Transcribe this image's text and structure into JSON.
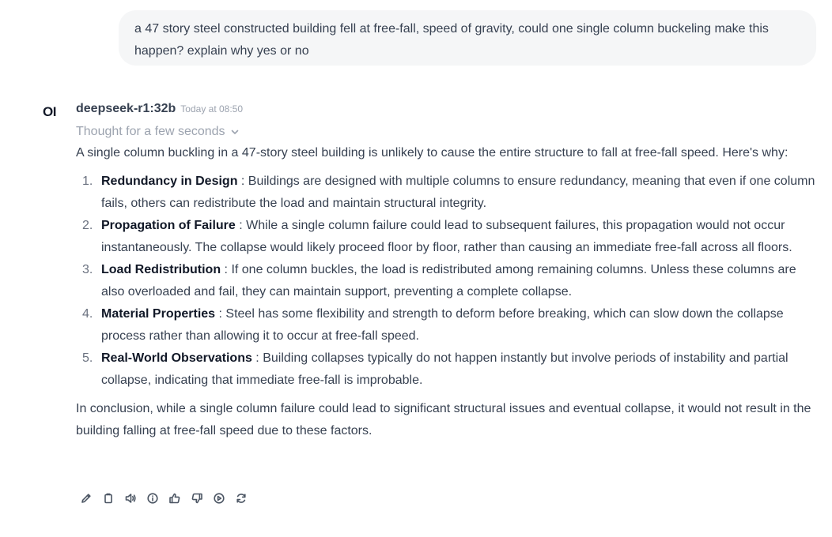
{
  "user_message": "a 47 story steel constructed building fell at free-fall, speed of gravity, could one single column buckeling make this happen? explain why yes or no",
  "assistant": {
    "avatar": "OI",
    "model": "deepseek-r1:32b",
    "timestamp": "Today at 08:50",
    "thought": "Thought for a few seconds",
    "intro": "A single column buckling in a 47-story steel building is unlikely to cause the entire structure to fall at free-fall speed. Here's why:",
    "points": [
      {
        "num": "1.",
        "title": "Redundancy in Design",
        "text": " : Buildings are designed with multiple columns to ensure redundancy, meaning that even if one column fails, others can redistribute the load and maintain structural integrity."
      },
      {
        "num": "2.",
        "title": "Propagation of Failure",
        "text": " : While a single column failure could lead to subsequent failures, this propagation would not occur instantaneously. The collapse would likely proceed floor by floor, rather than causing an immediate free-fall across all floors."
      },
      {
        "num": "3.",
        "title": "Load Redistribution",
        "text": " : If one column buckles, the load is redistributed among remaining columns. Unless these columns are also overloaded and fail, they can maintain support, preventing a complete collapse."
      },
      {
        "num": "4.",
        "title": "Material Properties",
        "text": " : Steel has some flexibility and strength to deform before breaking, which can slow down the collapse process rather than allowing it to occur at free-fall speed."
      },
      {
        "num": "5.",
        "title": "Real-World Observations",
        "text": " : Building collapses typically do not happen instantly but involve periods of instability and partial collapse, indicating that immediate free-fall is improbable."
      }
    ],
    "conclusion": "In conclusion, while a single column failure could lead to significant structural issues and eventual collapse, it would not result in the building falling at free-fall speed due to these factors."
  },
  "action_icons": [
    "edit-icon",
    "copy-icon",
    "read-aloud-icon",
    "info-icon",
    "thumbs-up-icon",
    "thumbs-down-icon",
    "continue-icon",
    "regenerate-icon"
  ],
  "colors": {
    "bubble_bg": "#f5f6f7",
    "text": "#374151",
    "muted": "#9ca3af",
    "bold": "#111827"
  }
}
